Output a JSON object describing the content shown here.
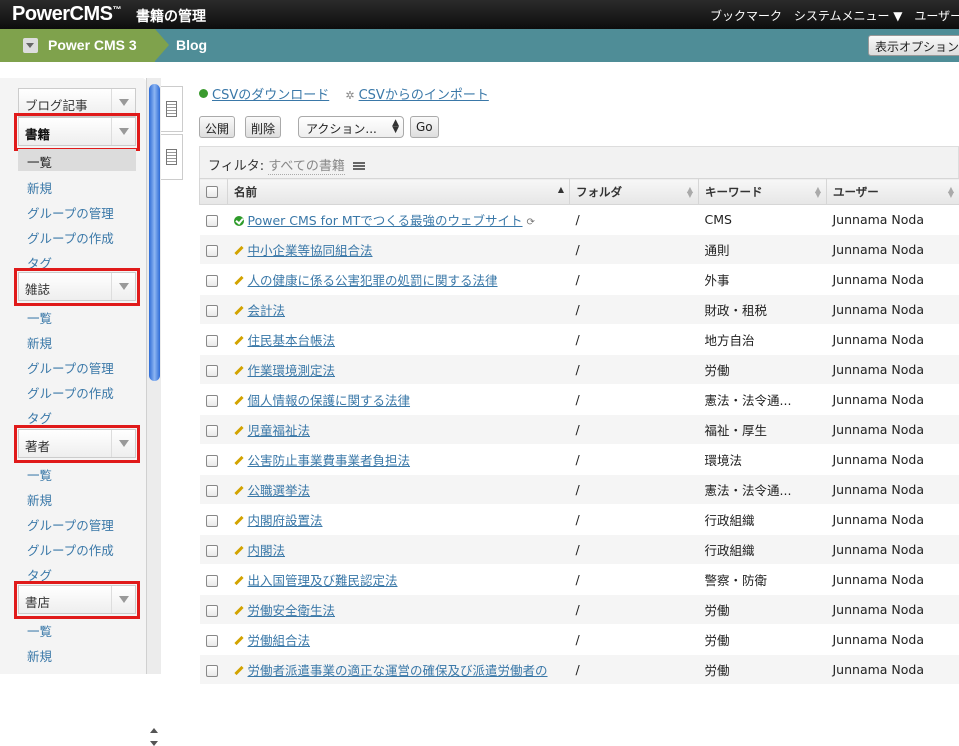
{
  "topbar": {
    "logo": "PowerCMS",
    "logo_tm": "™",
    "page_title": "書籍の管理",
    "menus": [
      "ブックマーク",
      "システムメニュー ▼",
      "ユーザー"
    ]
  },
  "crumbs": {
    "site": "Power CMS 3",
    "blog": "Blog",
    "display_options": "表示オプション"
  },
  "sidebar": {
    "groups": [
      {
        "label": "ブログ記事",
        "highlighted": false,
        "bold": false,
        "items": []
      },
      {
        "label": "書籍",
        "highlighted": true,
        "bold": true,
        "items": [
          "一覧",
          "新規",
          "グループの管理",
          "グループの作成",
          "タグ"
        ],
        "active_item": "一覧"
      },
      {
        "label": "雑誌",
        "highlighted": true,
        "bold": false,
        "items": [
          "一覧",
          "新規",
          "グループの管理",
          "グループの作成",
          "タグ"
        ]
      },
      {
        "label": "著者",
        "highlighted": true,
        "bold": false,
        "items": [
          "一覧",
          "新規",
          "グループの管理",
          "グループの作成",
          "タグ"
        ]
      },
      {
        "label": "書店",
        "highlighted": true,
        "bold": false,
        "items": [
          "一覧",
          "新規"
        ]
      }
    ]
  },
  "actions": {
    "csv_download": "CSVのダウンロード",
    "csv_import": "CSVからのインポート",
    "publish": "公開",
    "delete": "削除",
    "action_select": "アクション...",
    "go": "Go"
  },
  "filter": {
    "label": "フィルタ:",
    "value": "すべての書籍"
  },
  "table": {
    "columns": [
      "名前",
      "フォルダ",
      "キーワード",
      "ユーザー"
    ],
    "rows": [
      {
        "name": "Power CMS for MTでつくる最強のウェブサイト",
        "status": "published",
        "folder": "/",
        "keyword": "CMS",
        "user": "Junnama Noda"
      },
      {
        "name": "中小企業等協同組合法",
        "status": "draft",
        "folder": "/",
        "keyword": "通則",
        "user": "Junnama Noda"
      },
      {
        "name": "人の健康に係る公害犯罪の処罰に関する法律",
        "status": "draft",
        "folder": "/",
        "keyword": "外事",
        "user": "Junnama Noda"
      },
      {
        "name": "会計法",
        "status": "draft",
        "folder": "/",
        "keyword": "財政・租税",
        "user": "Junnama Noda"
      },
      {
        "name": "住民基本台帳法",
        "status": "draft",
        "folder": "/",
        "keyword": "地方自治",
        "user": "Junnama Noda"
      },
      {
        "name": "作業環境測定法",
        "status": "draft",
        "folder": "/",
        "keyword": "労働",
        "user": "Junnama Noda"
      },
      {
        "name": "個人情報の保護に関する法律",
        "status": "draft",
        "folder": "/",
        "keyword": "憲法・法令通...",
        "user": "Junnama Noda"
      },
      {
        "name": "児童福祉法",
        "status": "draft",
        "folder": "/",
        "keyword": "福祉・厚生",
        "user": "Junnama Noda"
      },
      {
        "name": "公害防止事業費事業者負担法",
        "status": "draft",
        "folder": "/",
        "keyword": "環境法",
        "user": "Junnama Noda"
      },
      {
        "name": "公職選挙法",
        "status": "draft",
        "folder": "/",
        "keyword": "憲法・法令通...",
        "user": "Junnama Noda"
      },
      {
        "name": "内閣府設置法",
        "status": "draft",
        "folder": "/",
        "keyword": "行政組織",
        "user": "Junnama Noda"
      },
      {
        "name": "内閣法",
        "status": "draft",
        "folder": "/",
        "keyword": "行政組織",
        "user": "Junnama Noda"
      },
      {
        "name": "出入国管理及び難民認定法",
        "status": "draft",
        "folder": "/",
        "keyword": "警察・防衛",
        "user": "Junnama Noda"
      },
      {
        "name": "労働安全衛生法",
        "status": "draft",
        "folder": "/",
        "keyword": "労働",
        "user": "Junnama Noda"
      },
      {
        "name": "労働組合法",
        "status": "draft",
        "folder": "/",
        "keyword": "労働",
        "user": "Junnama Noda"
      },
      {
        "name": "労働者派遣事業の適正な運営の確保及び派遣労働者の",
        "status": "draft",
        "folder": "/",
        "keyword": "労働",
        "user": "Junnama Noda"
      }
    ]
  }
}
